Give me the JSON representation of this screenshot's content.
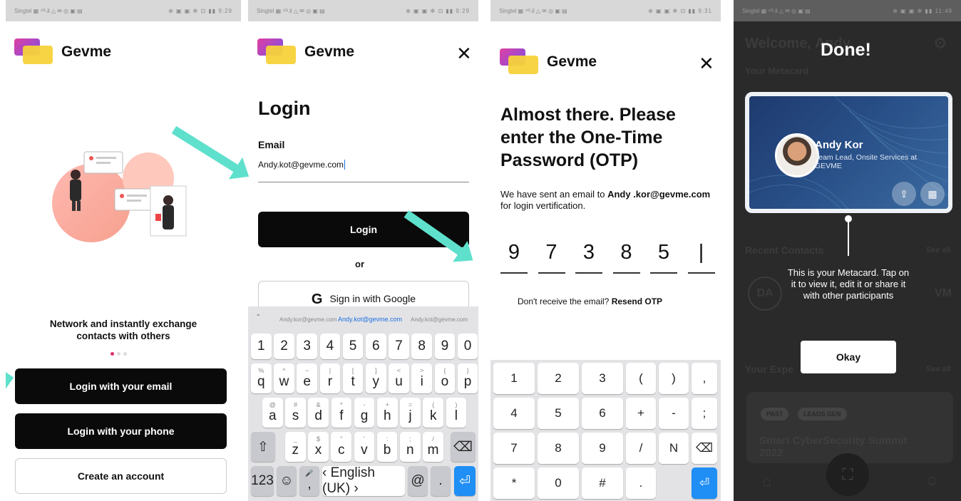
{
  "brand": {
    "name": "Gevme"
  },
  "status": {
    "left": "Singtel ▦ ⁴ᴳ.il △ ✉ ◎ ▣ ▤",
    "right1": "⊕ ▣ ▣ ✻ ⊡ ▮▮ 9:29",
    "right2": "⊕ ▣ ▣ ✻ ⊡ ▮▮ 9:29",
    "right3": "⊕ ▣ ▣ ✻ ⊡ ▮▮ 9:31",
    "right4": "⊕ ▣ ▣ ✻ ▮▮ 11:49"
  },
  "screen1": {
    "tagline": "Network and instantly exchange contacts with others",
    "btn_email": "Login with your email",
    "btn_phone": "Login with your phone",
    "btn_create": "Create an account"
  },
  "screen2": {
    "title": "Login",
    "email_label": "Email",
    "email_value": "Andy.kot@gevme.com",
    "btn_login": "Login",
    "or": "or",
    "btn_google": "Sign in with Google",
    "suggestions": [
      "Andy.kor@gevme.com",
      "Andy.kot@gevme.com",
      "Andy.kot@gevme.com"
    ],
    "row_numbers": [
      "1",
      "2",
      "3",
      "4",
      "5",
      "6",
      "7",
      "8",
      "9",
      "0"
    ],
    "row1": [
      [
        "%",
        "q"
      ],
      [
        "^",
        "w"
      ],
      [
        "~",
        "e"
      ],
      [
        "|",
        "r"
      ],
      [
        "[",
        "t"
      ],
      [
        "]",
        "y"
      ],
      [
        "<",
        "u"
      ],
      [
        ">",
        "i"
      ],
      [
        "{",
        "o"
      ],
      [
        "}",
        "p"
      ]
    ],
    "row2": [
      [
        "@",
        "a"
      ],
      [
        "#",
        "s"
      ],
      [
        "&",
        "d"
      ],
      [
        "*",
        "f"
      ],
      [
        "-",
        "g"
      ],
      [
        "+",
        "h"
      ],
      [
        "=",
        "j"
      ],
      [
        "(",
        "k"
      ],
      [
        ")",
        "l"
      ]
    ],
    "row3": [
      [
        "_",
        "z"
      ],
      [
        "$",
        "x"
      ],
      [
        "\"",
        "c"
      ],
      [
        "'",
        "v"
      ],
      [
        ":",
        "b"
      ],
      [
        ";",
        "n"
      ],
      [
        "/",
        "m"
      ]
    ],
    "key_123": "123",
    "key_space": "English (UK)",
    "key_at": "@",
    "key_dot": "."
  },
  "screen3": {
    "title": "Almost there. Please enter the One-Time Password (OTP)",
    "msg_pre": "We have sent an email to ",
    "msg_email": "Andy .kor@gevme.com",
    "msg_post": " for login vertification.",
    "digits": [
      "9",
      "7",
      "3",
      "8",
      "5",
      "|"
    ],
    "resend_pre": "Don't receive the email? ",
    "resend": "Resend OTP",
    "numpad": [
      "1",
      "2",
      "3",
      "(",
      ")",
      ",",
      "4",
      "5",
      "6",
      "+",
      "-",
      ";",
      "7",
      "8",
      "9",
      "/",
      "N",
      "⌫",
      "*",
      "0",
      "#",
      ".",
      "",
      ""
    ]
  },
  "screen4": {
    "done": "Done!",
    "welcome": "Welcome, Andy",
    "your_metacard": "Your Metacard",
    "name": "Andy Kor",
    "role": "Team Lead, Onsite Services at GEVME",
    "recent": "Recent Contacts",
    "see_all": "See all",
    "contacts": [
      "DA",
      "VM"
    ],
    "tooltip": "This is your Metacard. Tap on it to view it, edit it or share it with other participants",
    "okay": "Okay",
    "your_events": "Your Expe",
    "tags": [
      "PAST",
      "LEADS GEN"
    ],
    "event": "Smart CyberSecurity Summit 2022"
  }
}
